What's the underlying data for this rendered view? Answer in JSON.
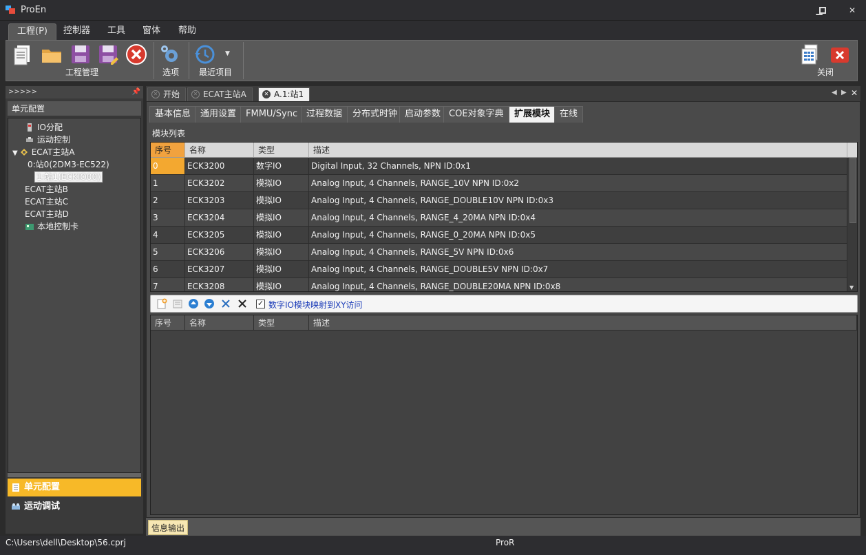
{
  "window": {
    "title": "ProEn"
  },
  "menu": [
    "工程(P)",
    "控制器",
    "工具",
    "窗体",
    "帮助"
  ],
  "ribbon": {
    "groups": {
      "project": "工程管理",
      "options": "选项",
      "recent": "最近项目",
      "close": "关闭"
    }
  },
  "left_panel": {
    "header": ">>>>>",
    "title": "单元配置",
    "tree": [
      "IO分配",
      "运动控制",
      "ECAT主站A",
      "0:站0(2DM3-EC522)",
      "1:站1(ECKIO00)",
      "ECAT主站B",
      "ECAT主站C",
      "ECAT主站D",
      "本地控制卡"
    ],
    "tabs": [
      "单元配置",
      "运动调试"
    ]
  },
  "doc_tabs": [
    "开始",
    "ECAT主站A",
    "A.1:站1"
  ],
  "sub_tabs": [
    "基本信息",
    "通用设置",
    "FMMU/Sync",
    "过程数据",
    "分布式时钟",
    "启动参数",
    "COE对象字典",
    "扩展模块",
    "在线"
  ],
  "module_list": {
    "label": "模块列表",
    "columns": [
      "序号",
      "名称",
      "类型",
      "描述"
    ],
    "rows": [
      [
        "0",
        "ECK3200",
        "数字IO",
        "Digital Input, 32 Channels, NPN ID:0x1"
      ],
      [
        "1",
        "ECK3202",
        "模拟IO",
        "Analog Input, 4 Channels, RANGE_10V NPN ID:0x2"
      ],
      [
        "2",
        "ECK3203",
        "模拟IO",
        "Analog Input, 4 Channels, RANGE_DOUBLE10V NPN ID:0x3"
      ],
      [
        "3",
        "ECK3204",
        "模拟IO",
        "Analog Input, 4 Channels, RANGE_4_20MA NPN ID:0x4"
      ],
      [
        "4",
        "ECK3205",
        "模拟IO",
        "Analog Input, 4 Channels, RANGE_0_20MA NPN ID:0x5"
      ],
      [
        "5",
        "ECK3206",
        "模拟IO",
        "Analog Input, 4 Channels, RANGE_5V NPN ID:0x6"
      ],
      [
        "6",
        "ECK3207",
        "模拟IO",
        "Analog Input, 4 Channels, RANGE_DOUBLE5V NPN ID:0x7"
      ],
      [
        "7",
        "ECK3208",
        "模拟IO",
        "Analog Input, 4 Channels, RANGE_DOUBLE20MA NPN ID:0x8"
      ]
    ]
  },
  "toolbar": {
    "checkbox_label": "数字IO模块映射到XY访问"
  },
  "lower_grid": {
    "columns": [
      "序号",
      "名称",
      "类型",
      "描述"
    ]
  },
  "bottom_tab": "信息输出",
  "status": {
    "path": "C:\\Users\\dell\\Desktop\\56.cprj",
    "app": "ProR"
  },
  "colors": {
    "accent": "#f3a830",
    "selected_tab": "#f7b928"
  }
}
